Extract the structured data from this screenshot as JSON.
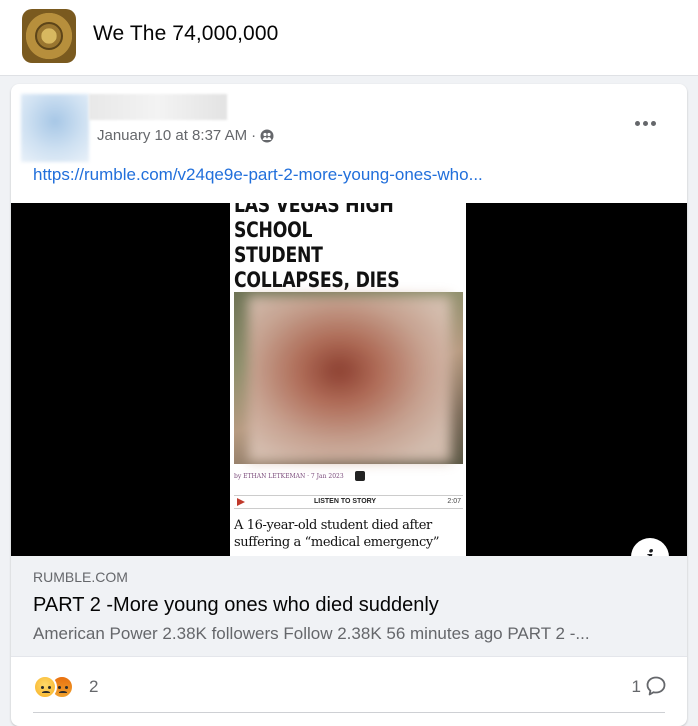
{
  "group": {
    "name": "We The 74,000,000",
    "avatar_icon": "group-seal-logo"
  },
  "post": {
    "timestamp": "January 10 at 8:37 AM",
    "separator": "·",
    "privacy_icon": "group-members-icon",
    "more_icon": "more-options-icon",
    "link_text": "https://rumble.com/v24qe9e-part-2-more-young-ones-who..."
  },
  "video": {
    "headline": "LAS VEGAS HIGH SCHOOL\nSTUDENT COLLAPSES, DIES\nAFTER PLAYING FLAG\nFOOTBALL",
    "byline": "by ETHAN LETKEMAN  ·  7 Jan 2023",
    "listen_label": "LISTEN TO STORY",
    "listen_time": "2:07",
    "lede": "A 16-year-old student died after\nsuffering a “medical emergency”",
    "info_label": "i"
  },
  "preview": {
    "domain": "RUMBLE.COM",
    "title": "PART 2 -More young ones who died suddenly",
    "description": "American Power 2.38K followers Follow 2.38K 56 minutes ago PART 2 -..."
  },
  "reactions": {
    "icons": [
      "sad-reaction-icon",
      "angry-reaction-icon"
    ],
    "count": "2",
    "comment_count": "1",
    "comment_icon": "comment-icon"
  },
  "colors": {
    "link": "#216fdb",
    "secondary_text": "#65676b",
    "background": "#f0f2f5"
  }
}
